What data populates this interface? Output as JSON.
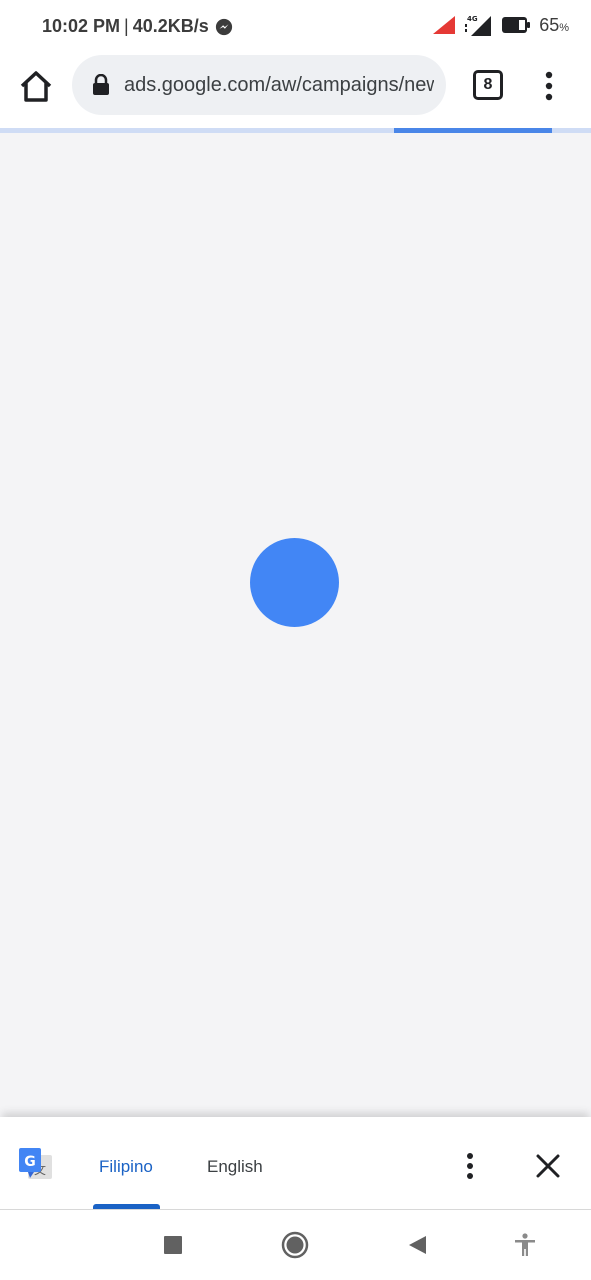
{
  "status_bar": {
    "time": "10:02 PM",
    "separator": "|",
    "net_speed": "40.2KB/s",
    "network_label": "4G",
    "battery_percent": "65",
    "battery_unit": "%"
  },
  "toolbar": {
    "url": "ads.google.com/aw/campaigns/new",
    "tab_count": "8"
  },
  "page": {
    "loading_progress": 0.27
  },
  "translate_bar": {
    "source_language": "Filipino",
    "target_language": "English",
    "selected": "Filipino"
  },
  "icons": {
    "home": "home-icon",
    "lock": "lock-icon",
    "menu": "more-vert-icon",
    "translate": "google-translate-icon",
    "close": "close-icon",
    "messenger": "messenger-icon"
  },
  "colors": {
    "accent": "#4286f5",
    "progress_fill": "#4a86e8",
    "progress_track": "#cfdcf5",
    "selected_tab": "#1a62c5",
    "content_bg": "#f4f4f6",
    "signal_warning": "#e53935"
  }
}
